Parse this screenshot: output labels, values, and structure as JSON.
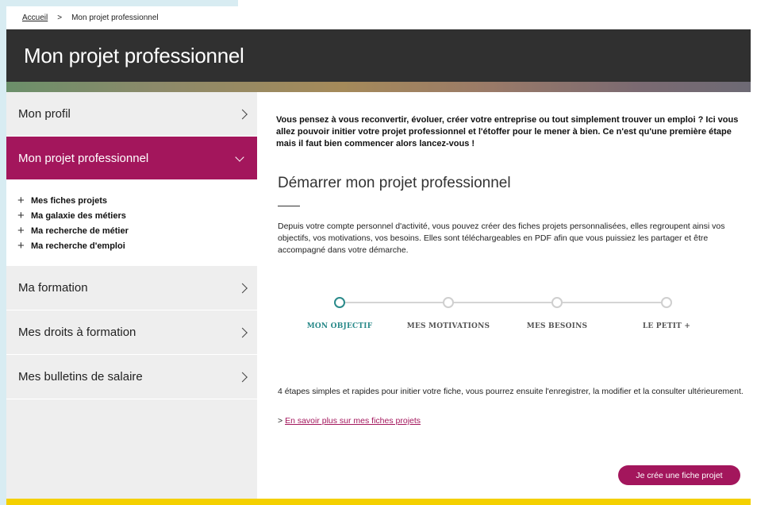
{
  "breadcrumb": {
    "home": "Accueil",
    "separator": ">",
    "current": "Mon projet professionnel"
  },
  "header": {
    "title": "Mon projet professionnel"
  },
  "sidebar": {
    "profile": "Mon profil",
    "project": "Mon projet professionnel",
    "subitems": [
      "Mes fiches projets",
      "Ma galaxie des métiers",
      "Ma recherche de métier",
      "Ma recherche d'emploi"
    ],
    "formation": "Ma formation",
    "rights": "Mes droits à formation",
    "payslips": "Mes bulletins de salaire"
  },
  "main": {
    "intro": "Vous pensez à vous reconvertir, évoluer, créer votre entreprise ou tout simplement trouver un emploi ? Ici vous allez pouvoir initier votre projet professionnel et l'étoffer pour le mener à bien. Ce n'est qu'une première étape mais il faut bien commencer alors lancez-vous !",
    "section_title": "Démarrer mon projet professionnel",
    "description": "Depuis votre compte personnel d'activité, vous pouvez créer des fiches projets personnalisées, elles regroupent ainsi vos objectifs, vos motivations, vos besoins. Elles sont téléchargeables en PDF afin que vous puissiez les partager et être accompagné dans votre démarche.",
    "steps": [
      "MON OBJECTIF",
      "MES MOTIVATIONS",
      "MES BESOINS",
      "LE PETIT +"
    ],
    "active_step": 0,
    "steps_note": "4 étapes simples et rapides pour initier votre fiche, vous pourrez ensuite l'enregistrer, la modifier et la consulter ultérieurement.",
    "more_prefix": ">",
    "more_link": "En savoir plus sur mes fiches projets",
    "cta": "Je crée une fiche projet"
  },
  "colors": {
    "accent": "#a3165c",
    "teal": "#2a8a8a",
    "header_bg": "#303030",
    "footer": "#f4d000"
  }
}
